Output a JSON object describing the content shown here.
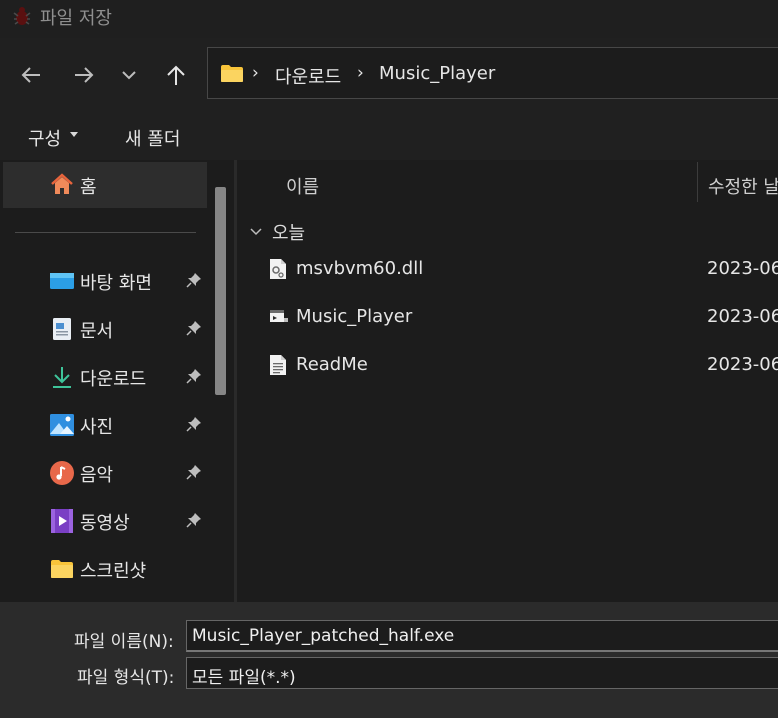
{
  "window": {
    "title": "파일 저장"
  },
  "nav": {
    "back_icon": "arrow-left-icon",
    "forward_icon": "arrow-right-icon",
    "recent_icon": "chevron-down-icon",
    "up_icon": "arrow-up-icon"
  },
  "breadcrumb": {
    "items": [
      "다운로드",
      "Music_Player"
    ]
  },
  "toolbar": {
    "organize_label": "구성",
    "new_folder_label": "새 폴더"
  },
  "sidebar": {
    "home_label": "홈",
    "items": [
      {
        "label": "바탕 화면",
        "icon": "desktop-icon",
        "pinned": true
      },
      {
        "label": "문서",
        "icon": "document-icon",
        "pinned": true
      },
      {
        "label": "다운로드",
        "icon": "download-icon",
        "pinned": true
      },
      {
        "label": "사진",
        "icon": "picture-icon",
        "pinned": true
      },
      {
        "label": "음악",
        "icon": "music-icon",
        "pinned": true
      },
      {
        "label": "동영상",
        "icon": "video-icon",
        "pinned": true
      },
      {
        "label": "스크린샷",
        "icon": "folder-icon",
        "pinned": false
      }
    ]
  },
  "filelist": {
    "columns": {
      "name": "이름",
      "date": "수정한 날"
    },
    "group_label": "오늘",
    "files": [
      {
        "name": "msvbvm60.dll",
        "date": "2023-06-",
        "icon": "dll-file-icon"
      },
      {
        "name": "Music_Player",
        "date": "2023-06-",
        "icon": "exe-file-icon"
      },
      {
        "name": "ReadMe",
        "date": "2023-06-",
        "icon": "text-file-icon"
      }
    ]
  },
  "form": {
    "filename_label": "파일 이름(N):",
    "filename_value": "Music_Player_patched_half.exe",
    "filetype_label": "파일 형식(T):",
    "filetype_value": "모든 파일(*.*)"
  },
  "colors": {
    "accent_folder": "#f8c43a",
    "background": "#1c1c1c",
    "selected": "#2d2d2d"
  }
}
